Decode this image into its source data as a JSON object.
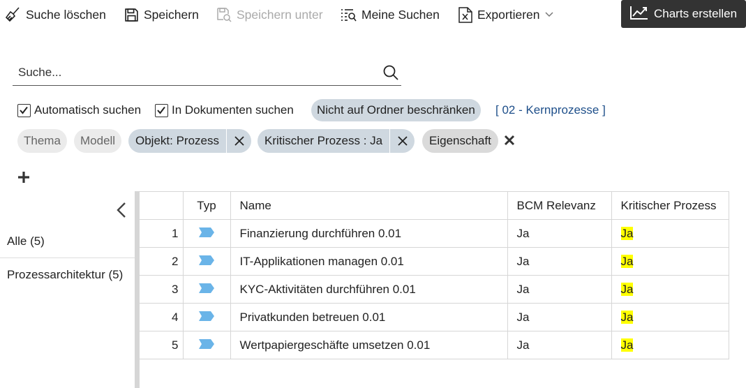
{
  "toolbar": {
    "clear_label": "Suche löschen",
    "save_label": "Speichern",
    "save_as_label": "Speichern unter",
    "my_searches_label": "Meine Suchen",
    "export_label": "Exportieren",
    "charts_label": "Charts erstellen"
  },
  "search": {
    "placeholder": "Suche..."
  },
  "options": {
    "auto_search": {
      "label": "Automatisch suchen",
      "checked": true
    },
    "in_docs": {
      "label": "In Dokumenten suchen",
      "checked": true
    },
    "folder_pill": "Nicht auf Ordner beschränken",
    "folder_link": "[ 02 - Kernprozesse ]"
  },
  "filters": {
    "chips": [
      "Thema",
      "Modell"
    ],
    "active": [
      "Objekt: Prozess",
      "Kritischer Prozess : Ja"
    ],
    "property": "Eigenschaft"
  },
  "sidebar": {
    "items": [
      {
        "label": "Alle (5)"
      },
      {
        "label": "Prozessarchitektur (5)"
      }
    ]
  },
  "table": {
    "headers": [
      "",
      "Typ",
      "Name",
      "BCM Relevanz",
      "Kritischer Prozess"
    ],
    "rows": [
      {
        "num": "1",
        "name": "Finanzierung durchführen 0.01",
        "bcm": "Ja",
        "critical": "Ja"
      },
      {
        "num": "2",
        "name": "IT-Applikationen managen 0.01",
        "bcm": "Ja",
        "critical": "Ja"
      },
      {
        "num": "3",
        "name": "KYC-Aktivitäten durchführen 0.01",
        "bcm": "Ja",
        "critical": "Ja"
      },
      {
        "num": "4",
        "name": "Privatkunden betreuen 0.01",
        "bcm": "Ja",
        "critical": "Ja"
      },
      {
        "num": "5",
        "name": "Wertpapiergeschäfte umsetzen 0.01",
        "bcm": "Ja",
        "critical": "Ja"
      }
    ],
    "type_icon": "process-arrow-icon",
    "type_icon_color": "#6ab4e8",
    "highlight_color": "#ffff00"
  }
}
